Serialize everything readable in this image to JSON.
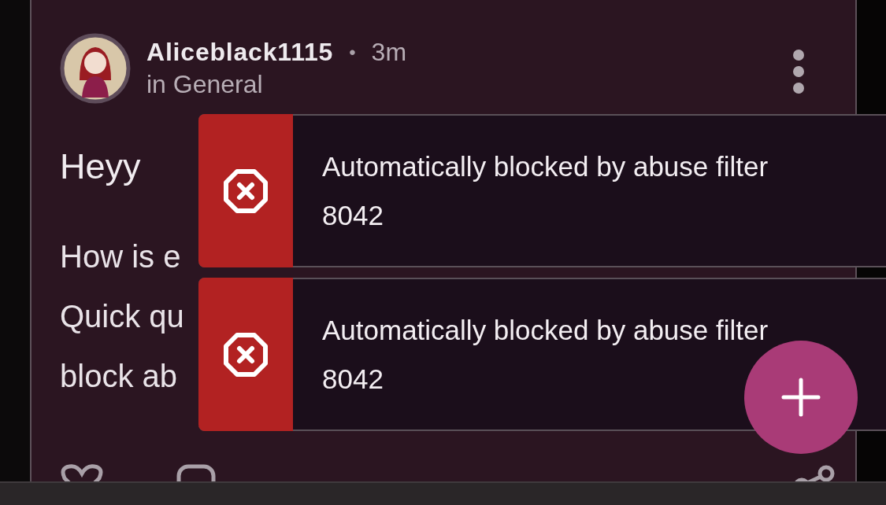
{
  "post": {
    "author": "Aliceblack1115",
    "separator": "•",
    "time": "3m",
    "community": "in General",
    "title": "Heyy",
    "body_lines": [
      "How is e",
      "Quick qu",
      "block ab"
    ]
  },
  "toasts": [
    {
      "kind": "error",
      "message": "Automatically blocked by abuse filter",
      "code": "8042"
    },
    {
      "kind": "error",
      "message": "Automatically blocked by abuse filter",
      "code": "8042"
    }
  ]
}
